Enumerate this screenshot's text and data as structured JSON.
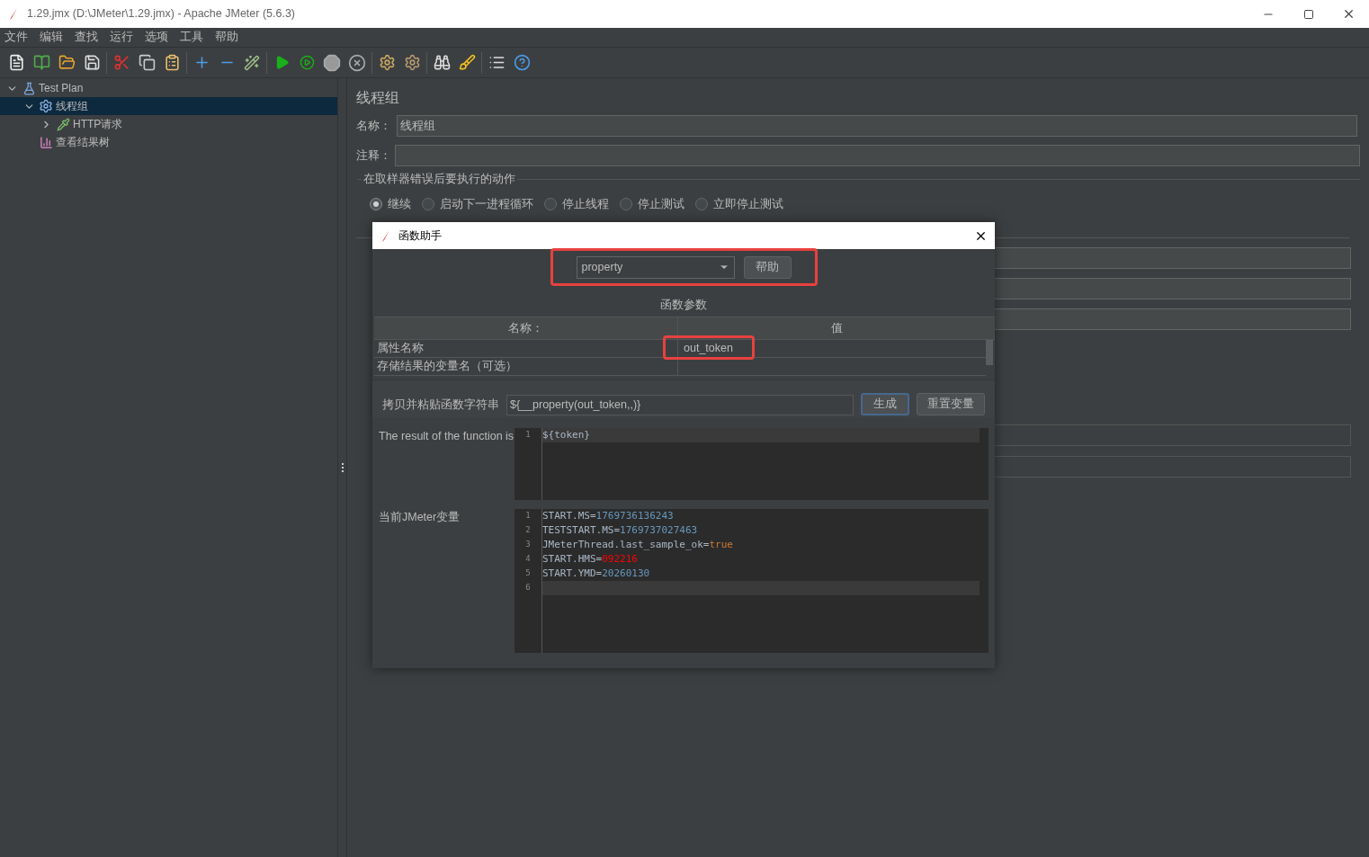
{
  "window": {
    "title": "1.29.jmx (D:\\JMeter\\1.29.jmx) - Apache JMeter (5.6.3)"
  },
  "menu": [
    "文件",
    "编辑",
    "查找",
    "运行",
    "选项",
    "工具",
    "帮助"
  ],
  "tree": [
    {
      "label": "Test Plan",
      "kind": "plan",
      "expanded": true,
      "selected": false,
      "children": [
        {
          "label": "线程组",
          "kind": "threads",
          "expanded": true,
          "selected": true,
          "children": [
            {
              "label": "HTTP请求",
              "kind": "sampler",
              "expanded": false,
              "selected": false
            }
          ]
        },
        {
          "label": "查看结果树",
          "kind": "listener",
          "selected": false
        }
      ]
    }
  ],
  "panel": {
    "title": "线程组",
    "name_label": "名称：",
    "name_value": "线程组",
    "comment_label": "注释：",
    "error_group_title": "在取样器错误后要执行的动作",
    "error_actions": [
      {
        "label": "继续",
        "selected": true
      },
      {
        "label": "启动下一进程循环",
        "selected": false
      },
      {
        "label": "停止线程",
        "selected": false
      },
      {
        "label": "停止测试",
        "selected": false
      },
      {
        "label": "立即停止测试",
        "selected": false
      }
    ]
  },
  "dialog": {
    "title": "函数助手",
    "function": "property",
    "function_highlighted": true,
    "help_button": "帮助",
    "params_title": "函数参数",
    "columns": [
      "名称：",
      "值"
    ],
    "rows": [
      {
        "name": "属性名称",
        "value": "out_token",
        "highlighted": true
      },
      {
        "name": "存储结果的变量名（可选）"
      }
    ],
    "copy_label": "拷贝并粘贴函数字符串",
    "copy_value": "${__property(out_token,,)}",
    "generate_button": "生成",
    "reset_button": "重置变量",
    "result_label": "The result of the function is",
    "result_lines": [
      {
        "number": "1",
        "key": "${token}",
        "current": true
      }
    ],
    "variables_label": "当前JMeter变量",
    "variable_lines": [
      {
        "number": "1",
        "key": "START.MS=",
        "value": "1769736136243",
        "color": "#6897bb",
        "current": false
      },
      {
        "number": "2",
        "key": "TESTSTART.MS=",
        "value": "1769737027463",
        "color": "#6897bb",
        "current": false
      },
      {
        "number": "3",
        "key": "JMeterThread.last_sample_ok=",
        "value": "true",
        "color": "#cc7832",
        "current": false
      },
      {
        "number": "4",
        "key": "START.HMS=",
        "value": "092216",
        "color": "#ff0000",
        "current": false
      },
      {
        "number": "5",
        "key": "START.YMD=",
        "value": "20260130",
        "color": "#6897bb",
        "current": false
      },
      {
        "number": "6",
        "current": true
      }
    ]
  }
}
